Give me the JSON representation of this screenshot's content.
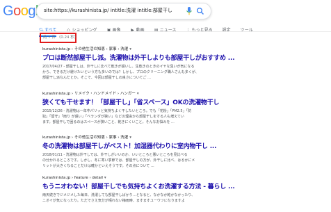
{
  "logo": {
    "text": "Google"
  },
  "search": {
    "query": "site:https://kurashinista.jp/ intitle:洗濯 intitle:部屋干し"
  },
  "tabs": [
    {
      "label": "すべて",
      "icon": "search-icon"
    },
    {
      "label": "ショッピング",
      "icon": "tag-icon"
    },
    {
      "label": "画像",
      "icon": "image-icon"
    },
    {
      "label": "動画",
      "icon": "video-icon"
    },
    {
      "label": "ニュース",
      "icon": "news-icon"
    },
    {
      "label": "もっと見る",
      "icon": "more-icon"
    },
    {
      "label": "設定",
      "icon": ""
    },
    {
      "label": "ツール",
      "icon": ""
    }
  ],
  "stats": "約 7 件 （0.24 秒）",
  "results": [
    {
      "url": "kurashinista.jp › その他生活の知恵 › 家事 › 洗濯",
      "title": "プロは断然部屋干し派。洗濯物は外干しよりも部屋干しがおすすめ ...",
      "snippet": [
        "2017/04/27 - 部屋干しは、外干しに比べて乾きが遅いし、生乾きのときのイヤな臭いが気になる",
        "から、できるだけ避けたいという方も多いのでは？しかし、プロのクリーニング職人さんも多くが、",
        "部屋干し派なんだとか。そこで、今回は部屋干しの良さについてご ..."
      ]
    },
    {
      "url": "kurashinista.jp › リメイク・ハンドメイド › ハンガー",
      "title": "狭くても干せます！「部屋干し」「省スペース」OKの洗濯物干し",
      "snippet": [
        "2015/12/26 - 洗濯物は一年中パリッと気持ちよく干したいところ。でも「花粉」「PM2.5」「防",
        "犯」「留守」「雨り が遅い」「ベランダが狭い」などの理由から部屋干しをする人も増えてい",
        "ます。部屋干しで困るのはスペースが狭いこと、乾きにくいこと。そんなお悩みを ..."
      ]
    },
    {
      "url": "kurashinista.jp › その他生活の知恵 › 家事 › 洗濯",
      "title": "冬の洗濯物は部屋干しがベスト！加湿器代わりに室内物干し ...",
      "snippet": [
        "2018/01/11 - 洗濯物は外干しでは、外干しがいいのか、いいところと悪いところを見比べる",
        "の分かれるところです。しかし、冬に寒い季節では、部屋干しの方が、外干しに比べ、はるかにメ",
        "リットが大きくなることだけは確かといえそうです。その点について ..."
      ]
    },
    {
      "url": "kurashinista.jp › feature › detail",
      "title": "もうニオわない！部屋干しでも気持ちよくお洗濯する方法 - 暮らし ...",
      "snippet": [
        "雨天続きでジメジメした毎日、洗濯しても部屋干しばかり…となると、なかなか乾かなかったり、",
        "ニオイが気になったり。ただでさえ気分が晴れない梅雨時、ますますユーウツになりますよ"
      ]
    }
  ]
}
